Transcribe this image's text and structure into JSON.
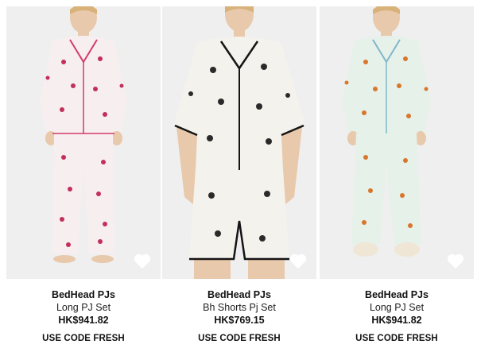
{
  "products": [
    {
      "brand": "BedHead PJs",
      "name": "Long PJ Set",
      "price": "HK$941.82",
      "promo": "USE CODE FRESH",
      "icon": "heart-icon",
      "fabric": "#f7eef0",
      "print": "#c2305a",
      "trim": "#d23a6a"
    },
    {
      "brand": "BedHead PJs",
      "name": "Bh Shorts Pj Set",
      "price": "HK$769.15",
      "promo": "USE CODE FRESH",
      "icon": "heart-icon",
      "fabric": "#f4f2ec",
      "print": "#2a2a2a",
      "trim": "#151515"
    },
    {
      "brand": "BedHead PJs",
      "name": "Long PJ Set",
      "price": "HK$941.82",
      "promo": "USE CODE FRESH",
      "icon": "heart-icon",
      "fabric": "#e6f1ea",
      "print": "#d8772c",
      "trim": "#7fb7c9"
    }
  ]
}
